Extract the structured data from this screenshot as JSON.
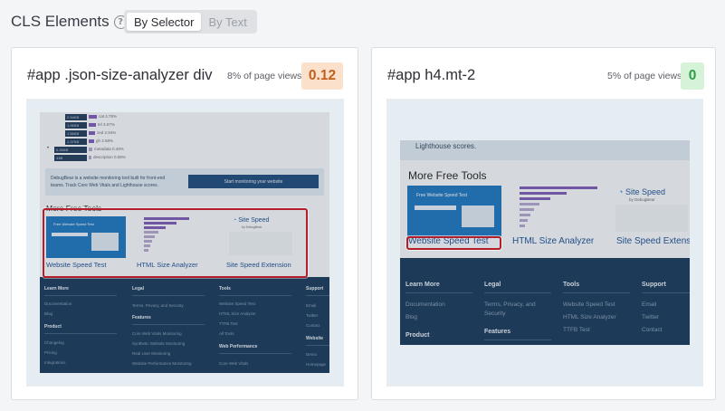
{
  "header": {
    "title": "CLS Elements",
    "help_icon": "?",
    "tabs": [
      {
        "label": "By Selector",
        "active": true
      },
      {
        "label": "By Text",
        "active": false
      }
    ]
  },
  "cards": [
    {
      "selector": "#app .json-size-analyzer div",
      "page_views": "8% of page views",
      "score": "0.12",
      "score_status": "needs-improvement",
      "screenshot": {
        "sizes": [
          {
            "size": "2.54KB",
            "key": "cat",
            "pct": "4.78%"
          },
          {
            "size": "1.95KB",
            "key": "tel",
            "pct": "3.67%"
          },
          {
            "size": "1.56KB",
            "key": "zed",
            "pct": "2.94%"
          },
          {
            "size": "1.37KB",
            "key": "gh",
            "pct": "2.58%"
          },
          {
            "size": "0.26KB",
            "key": "metadata",
            "pct": "0.49%"
          },
          {
            "size": "43B",
            "key": "description",
            "pct": "0.08%"
          }
        ],
        "promo_text_1": "DebugBear is a website monitoring tool built for front-end",
        "promo_text_2": "teams. Track Core Web Vitals and Lighthouse scores.",
        "promo_button": "Start monitoring your website",
        "section_title": "More Free Tools",
        "tools": [
          "Website Speed Test",
          "HTML Size Analyzer",
          "Site Speed Extension"
        ],
        "thumb_title": "Free Website Speed Test",
        "site_speed_logo": "Site Speed",
        "site_speed_by": "by DebugBear",
        "footer": {
          "learn_more": {
            "heading": "Learn More",
            "links": [
              "Documentation",
              "Blog"
            ]
          },
          "product": {
            "heading": "Product",
            "links": [
              "Changelog",
              "Pricing",
              "Integrations"
            ]
          },
          "legal": {
            "heading": "Legal",
            "links": [
              "Terms, Privacy, and Security"
            ]
          },
          "features": {
            "heading": "Features",
            "links": [
              "Core Web Vitals Monitoring",
              "Synthetic Website Monitoring",
              "Real User Monitoring",
              "Website Performance Monitoring"
            ]
          },
          "tools": {
            "heading": "Tools",
            "links": [
              "Website Speed Test",
              "HTML Size Analyzer",
              "TTFB Test",
              "All Tools"
            ]
          },
          "web_performance": {
            "heading": "Web Performance",
            "links": [
              "Core Web Vitals"
            ]
          },
          "support": {
            "heading": "Support",
            "links": [
              "Email",
              "Twitter",
              "Contact"
            ]
          },
          "website": {
            "heading": "Website",
            "links": [
              "Demo",
              "Homepage"
            ]
          }
        }
      }
    },
    {
      "selector": "#app h4.mt-2",
      "page_views": "5% of page views",
      "score": "0",
      "score_status": "good",
      "screenshot": {
        "top_text": "Lighthouse scores.",
        "section_title": "More Free Tools",
        "tools": [
          "Website Speed Test",
          "HTML Size Analyzer",
          "Site Speed Extens"
        ],
        "thumb_title": "Free Website Speed Test",
        "site_speed_logo": "Site Speed",
        "site_speed_by": "by DebugBear",
        "footer": {
          "learn_more": {
            "heading": "Learn More",
            "links": [
              "Documentation",
              "Blog"
            ]
          },
          "product": {
            "heading": "Product"
          },
          "legal": {
            "heading": "Legal",
            "links": [
              "Terms, Privacy, and",
              "Security"
            ]
          },
          "features": {
            "heading": "Features"
          },
          "tools": {
            "heading": "Tools",
            "links": [
              "Website Speed Test",
              "HTML Size Analyzer",
              "TTFB Test"
            ]
          },
          "support": {
            "heading": "Support",
            "links": [
              "Email",
              "Twitter",
              "Contact"
            ]
          }
        }
      }
    }
  ],
  "colors": {
    "score_bad_bg": "#fbe0cc",
    "score_bad_text": "#c0601c",
    "score_good_bg": "#d6f2d8",
    "score_good_text": "#2f9d47",
    "highlight": "#b41e2a",
    "footer_bg": "#16375a"
  }
}
